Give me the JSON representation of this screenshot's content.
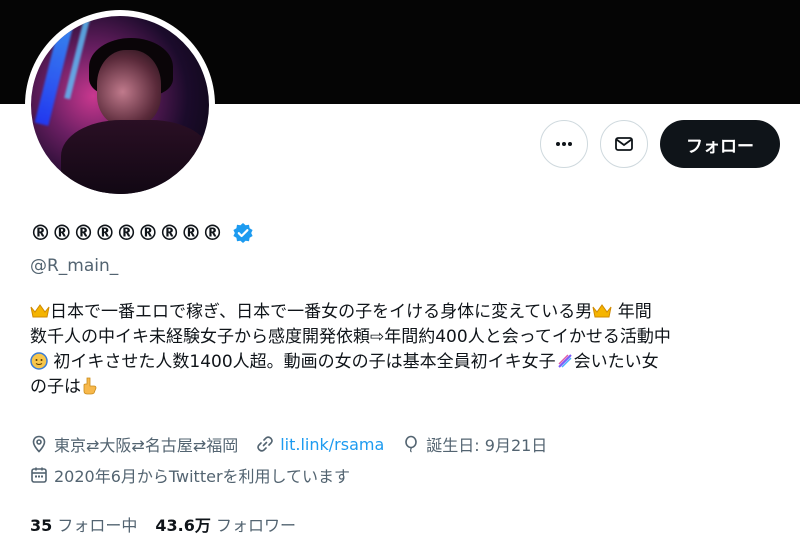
{
  "profile": {
    "display_name": "®®®®®®®®®",
    "handle": "@R_main_",
    "verified": true,
    "bio_line1_pre": "日本で一番エロで稼ぎ、日本で一番女の子をイける身体に変えている男",
    "bio_line1_post": " 年間",
    "bio_line2": "数千人の中イキ未経験女子から感度開発依頼⇨年間約400人と会ってイかせる活動中",
    "bio_line3_post": " 初イキさせた人数1400人超。動画の女の子は基本全員初イキ女子",
    "bio_line3_tail": "会いたい女",
    "bio_line4": "の子は",
    "location": "東京⇄大阪⇄名古屋⇄福岡",
    "link": "lit.link/rsama",
    "birthday": "誕生日: 9月21日",
    "joined": "2020年6月からTwitterを利用しています",
    "following_count": "35",
    "following_label": "フォロー中",
    "followers_count": "43.6万",
    "followers_label": "フォロワー"
  },
  "actions": {
    "follow_label": "フォロー"
  },
  "icons": {
    "more": "more-icon",
    "message": "mail-icon",
    "location": "location-pin-icon",
    "link": "link-icon",
    "birthday": "balloon-icon",
    "joined": "calendar-icon"
  },
  "colors": {
    "accent": "#1d9bf0",
    "text": "#0f1419",
    "secondary": "#536471",
    "follow_bg": "#0f1419"
  }
}
